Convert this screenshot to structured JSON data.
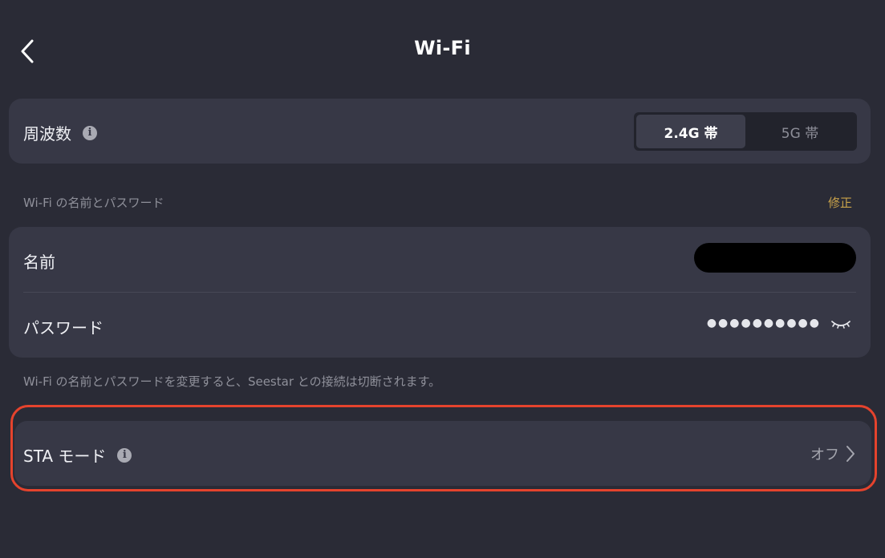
{
  "header": {
    "title": "Wi-Fi",
    "back_icon": "chevron-left-icon"
  },
  "frequency": {
    "label": "周波数",
    "info_icon": "info-icon",
    "options": [
      "2.4G 帯",
      "5G 帯"
    ],
    "selected": "2.4G 帯"
  },
  "credentials": {
    "section_caption": "Wi-Fi の名前とパスワード",
    "edit_label": "修正",
    "name_label": "名前",
    "password_label": "パスワード",
    "password_masked": "●●●●●●●●●●",
    "eye_icon": "eye-closed-icon"
  },
  "note": "Wi-Fi の名前とパスワードを変更すると、Seestar との接続は切断されます。",
  "sta": {
    "label": "STA モード",
    "info_icon": "info-icon",
    "value": "オフ",
    "chevron_icon": "chevron-right-icon"
  },
  "colors": {
    "background": "#2a2b36",
    "card": "#373846",
    "accent_edit": "#c9a24a",
    "highlight": "#e5432d"
  }
}
